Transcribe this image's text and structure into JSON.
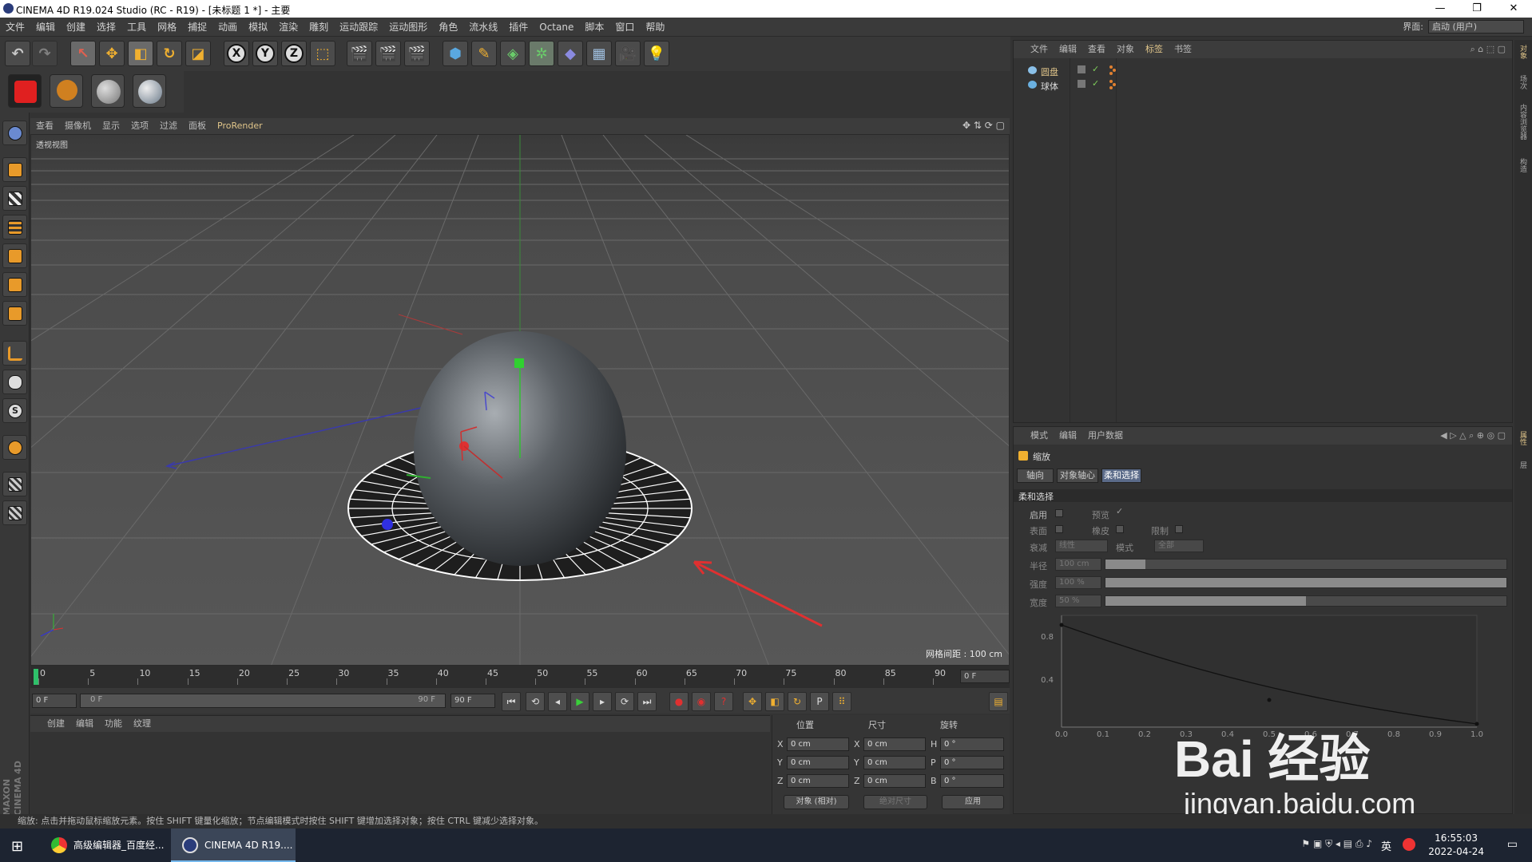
{
  "window": {
    "title": "CINEMA 4D R19.024 Studio (RC - R19) - [未标题 1 *] - 主要"
  },
  "menubar": {
    "items": [
      "文件",
      "编辑",
      "创建",
      "选择",
      "工具",
      "网格",
      "捕捉",
      "动画",
      "模拟",
      "渲染",
      "雕刻",
      "运动跟踪",
      "运动图形",
      "角色",
      "流水线",
      "插件",
      "Octane",
      "脚本",
      "窗口",
      "帮助"
    ],
    "interface_label": "界面:",
    "interface_value": "启动 (用户)"
  },
  "toolbar": {
    "axis_x": "X",
    "axis_y": "Y",
    "axis_z": "Z"
  },
  "viewport": {
    "menu": [
      "查看",
      "摄像机",
      "显示",
      "选项",
      "过滤",
      "面板",
      "ProRender"
    ],
    "label": "透视视图",
    "grid_spacing": "网格间距 : 100 cm"
  },
  "timeline": {
    "ticks": [
      "0",
      "5",
      "10",
      "15",
      "20",
      "25",
      "30",
      "35",
      "40",
      "45",
      "50",
      "55",
      "60",
      "65",
      "70",
      "75",
      "80",
      "85",
      "90"
    ],
    "end_frame": "0 F"
  },
  "playback": {
    "start": "0 F",
    "range_start": "0 F",
    "range_end": "90 F",
    "end": "90 F"
  },
  "material_panel": {
    "menu": [
      "创建",
      "编辑",
      "功能",
      "纹理"
    ],
    "brand_line1": "MAXON",
    "brand_line2": "CINEMA 4D"
  },
  "coords": {
    "header_position": "位置",
    "header_size": "尺寸",
    "header_rotation": "旋转",
    "rows": [
      {
        "axis": "X",
        "pos": "0 cm",
        "size_axis": "X",
        "size": "0 cm",
        "rot_axis": "H",
        "rot": "0 °"
      },
      {
        "axis": "Y",
        "pos": "0 cm",
        "size_axis": "Y",
        "size": "0 cm",
        "rot_axis": "P",
        "rot": "0 °"
      },
      {
        "axis": "Z",
        "pos": "0 cm",
        "size_axis": "Z",
        "size": "0 cm",
        "rot_axis": "B",
        "rot": "0 °"
      }
    ],
    "mode_select": "对象 (相对)",
    "size_select": "绝对尺寸",
    "apply": "应用"
  },
  "object_manager": {
    "menu": [
      "文件",
      "编辑",
      "查看",
      "对象",
      "标签",
      "书签"
    ],
    "objects": [
      {
        "name": "圆盘",
        "selected": true
      },
      {
        "name": "球体",
        "selected": false
      }
    ]
  },
  "attributes": {
    "menu": [
      "模式",
      "编辑",
      "用户数据"
    ],
    "title": "缩放",
    "tabs": [
      "轴向",
      "对象轴心",
      "柔和选择"
    ],
    "section": "柔和选择",
    "enable": "启用",
    "preview": "预览",
    "surface": "表面",
    "rubber": "橡皮",
    "restrict": "限制",
    "falloff": "衰减",
    "falloff_value": "线性",
    "mode": "模式",
    "mode_value": "全部",
    "radius": "半径",
    "radius_value": "100 cm",
    "radius_fill": 0.1,
    "strength": "强度",
    "strength_value": "100 %",
    "strength_fill": 1.0,
    "width": "宽度",
    "width_value": "50 %",
    "width_fill": 0.5,
    "curve_y_ticks": [
      "0.8",
      "0.4"
    ],
    "curve_x_ticks": [
      "0.0",
      "0.1",
      "0.2",
      "0.3",
      "0.4",
      "0.5",
      "0.6",
      "0.7",
      "0.8",
      "0.9",
      "1.0"
    ]
  },
  "right_side_tabs": [
    "对象",
    "场次",
    "内容浏览器",
    "构造",
    "属性",
    "层"
  ],
  "status": {
    "text": "缩放: 点击并拖动鼠标缩放元素。按住 SHIFT 键量化缩放；节点编辑模式时按住 SHIFT 键增加选择对象；按住 CTRL 键减少选择对象。"
  },
  "taskbar": {
    "task1": "高级编辑器_百度经...",
    "task2": "CINEMA 4D R19....",
    "lang": "英",
    "time": "16:55:03",
    "date": "2022-04-24"
  },
  "watermark": {
    "line1": "Bai 经验",
    "line2": "jingyan.baidu.com"
  },
  "colors": {
    "accent": "#e0c58a",
    "selected_tab": "#5a6a88",
    "taskbar": "#1d2431"
  }
}
